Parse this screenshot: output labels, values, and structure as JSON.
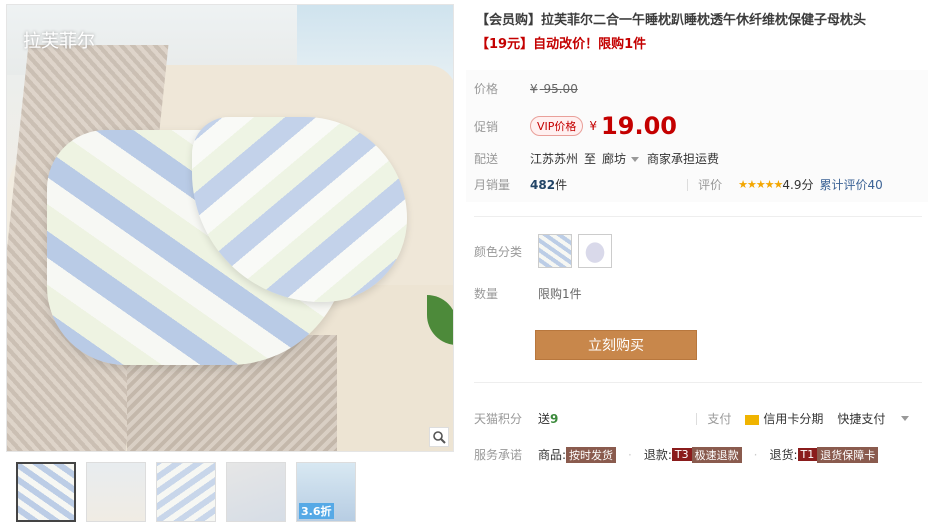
{
  "gallery": {
    "logo_text": "拉芙菲尔",
    "thumb_badge": "3.6折"
  },
  "product": {
    "title": "【会员购】拉芙菲尔二合一午睡枕趴睡枕透午休纤维枕保健子母枕头",
    "subtitle": "【19元】自动改价！限购1件"
  },
  "price": {
    "label": "价格",
    "currency": "¥",
    "original": "95.00"
  },
  "promo": {
    "label": "促销",
    "vip_tag": "VIP价格",
    "currency": "¥",
    "value": "19.00"
  },
  "delivery": {
    "label": "配送",
    "from": "江苏苏州",
    "to_word": "至",
    "destination": "廊坊",
    "shipping": "商家承担运费"
  },
  "sales": {
    "label": "月销量",
    "count": "482",
    "unit": "件",
    "rating_label": "评价",
    "stars": "★★★★★",
    "score": "4.9分",
    "total_reviews": "累计评价40"
  },
  "options": {
    "color_label": "颜色分类",
    "quantity_label": "数量",
    "quantity_value": "限购1件"
  },
  "buy_button": "立刻购买",
  "footer": {
    "points_label": "天猫积分",
    "points_text": "送",
    "points_value": "9",
    "pay_label": "支付",
    "credit_card": "信用卡分期",
    "quick_pay": "快捷支付",
    "service_label": "服务承诺",
    "goods_label": "商品:",
    "goods_tag": "按时发货",
    "refund_label": "退款:",
    "refund_code": "T3",
    "refund_tag": "极速退款",
    "return_label": "退货:",
    "return_code": "T1",
    "return_tag": "退货保障卡"
  }
}
